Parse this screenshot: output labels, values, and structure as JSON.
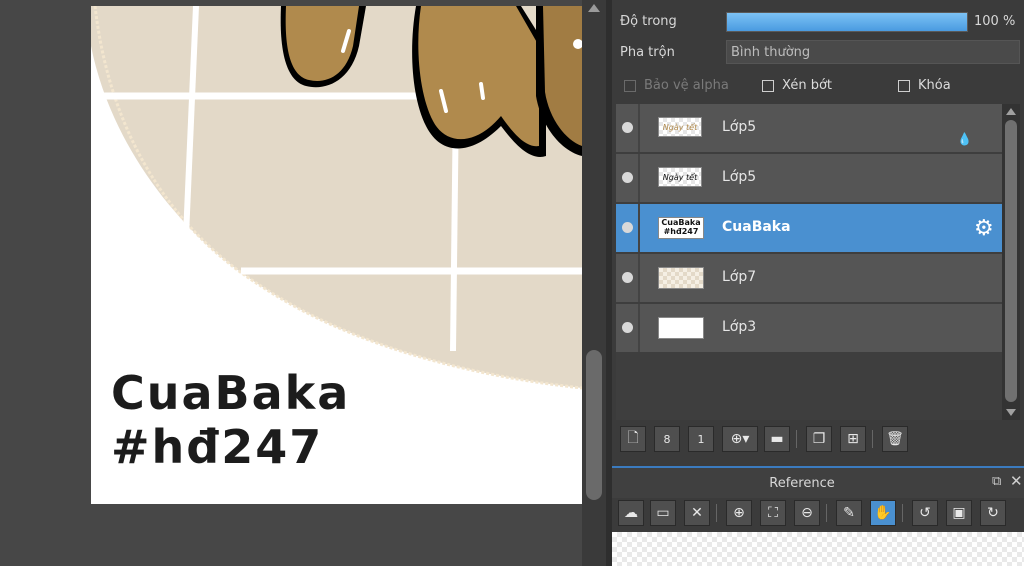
{
  "artwork": {
    "text_line1": "CuaBaka",
    "text_line2": "#hđ247"
  },
  "properties": {
    "opacity_label": "Độ trong",
    "opacity_value": "100 %",
    "opacity_fraction": 1.0,
    "blend_label": "Pha trộn",
    "blend_value": "Bình thường",
    "protect_alpha_label": "Bảo vệ alpha",
    "clip_label": "Xén bớt",
    "lock_label": "Khóa"
  },
  "layers": [
    {
      "name": "Lớp5",
      "thumb_text": "Ngày tết",
      "selected": false
    },
    {
      "name": "Lớp5",
      "thumb_text": "Ngày tết",
      "selected": false
    },
    {
      "name": "CuaBaka",
      "thumb_text": "CuaBaka #hđ247",
      "selected": true
    },
    {
      "name": "Lớp7",
      "thumb_text": "",
      "selected": false
    },
    {
      "name": "Lớp3",
      "thumb_text": "",
      "selected": false
    }
  ],
  "reference": {
    "title": "Reference"
  },
  "colors": {
    "selected_layer": "#4a90d0",
    "panel_bg": "#3b3b3b",
    "opacity_fill": "#5aaee8"
  }
}
